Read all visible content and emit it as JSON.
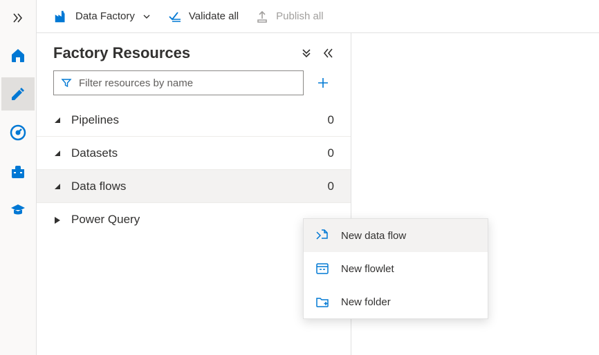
{
  "topbar": {
    "service_label": "Data Factory",
    "validate_label": "Validate all",
    "publish_label": "Publish all"
  },
  "panel": {
    "title": "Factory Resources",
    "filter_placeholder": "Filter resources by name"
  },
  "resources": [
    {
      "label": "Pipelines",
      "count": "0"
    },
    {
      "label": "Datasets",
      "count": "0"
    },
    {
      "label": "Data flows",
      "count": "0"
    },
    {
      "label": "Power Query",
      "count": ""
    }
  ],
  "context_menu": [
    {
      "label": "New data flow",
      "iconname": "dataflow-icon"
    },
    {
      "label": "New flowlet",
      "iconname": "flowlet-icon"
    },
    {
      "label": "New folder",
      "iconname": "new-folder-icon"
    }
  ]
}
